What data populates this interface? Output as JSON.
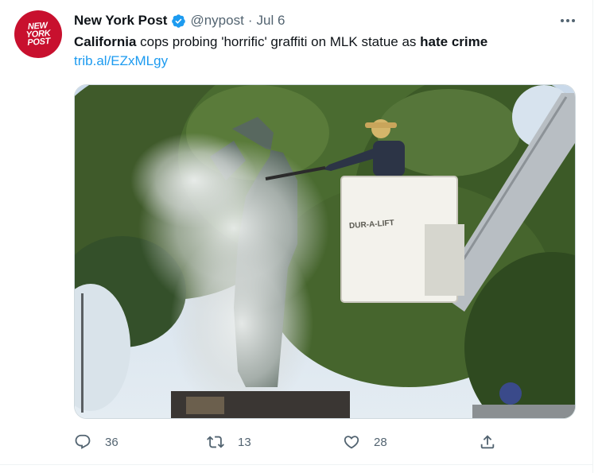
{
  "tweet": {
    "avatar_text": [
      "NEW",
      "YORK",
      "POST"
    ],
    "author_name": "New York Post",
    "handle": "@nypost",
    "separator": "·",
    "date": "Jul 6",
    "text_parts": {
      "bold1": "California",
      "mid": " cops probing 'horrific' graffiti on MLK statue as ",
      "bold2": "hate crime"
    },
    "link": "trib.al/EZxMLgy",
    "bucket_label": "DUR-A-LIFT"
  },
  "actions": {
    "reply_count": "36",
    "retweet_count": "13",
    "like_count": "28"
  },
  "icons": {
    "verified": "verified-badge-icon",
    "more": "more-horizontal-icon",
    "reply": "reply-icon",
    "retweet": "retweet-icon",
    "like": "heart-icon",
    "share": "share-icon"
  },
  "colors": {
    "brand_red": "#c8102e",
    "link_blue": "#1d9bf0",
    "muted": "#536471"
  }
}
